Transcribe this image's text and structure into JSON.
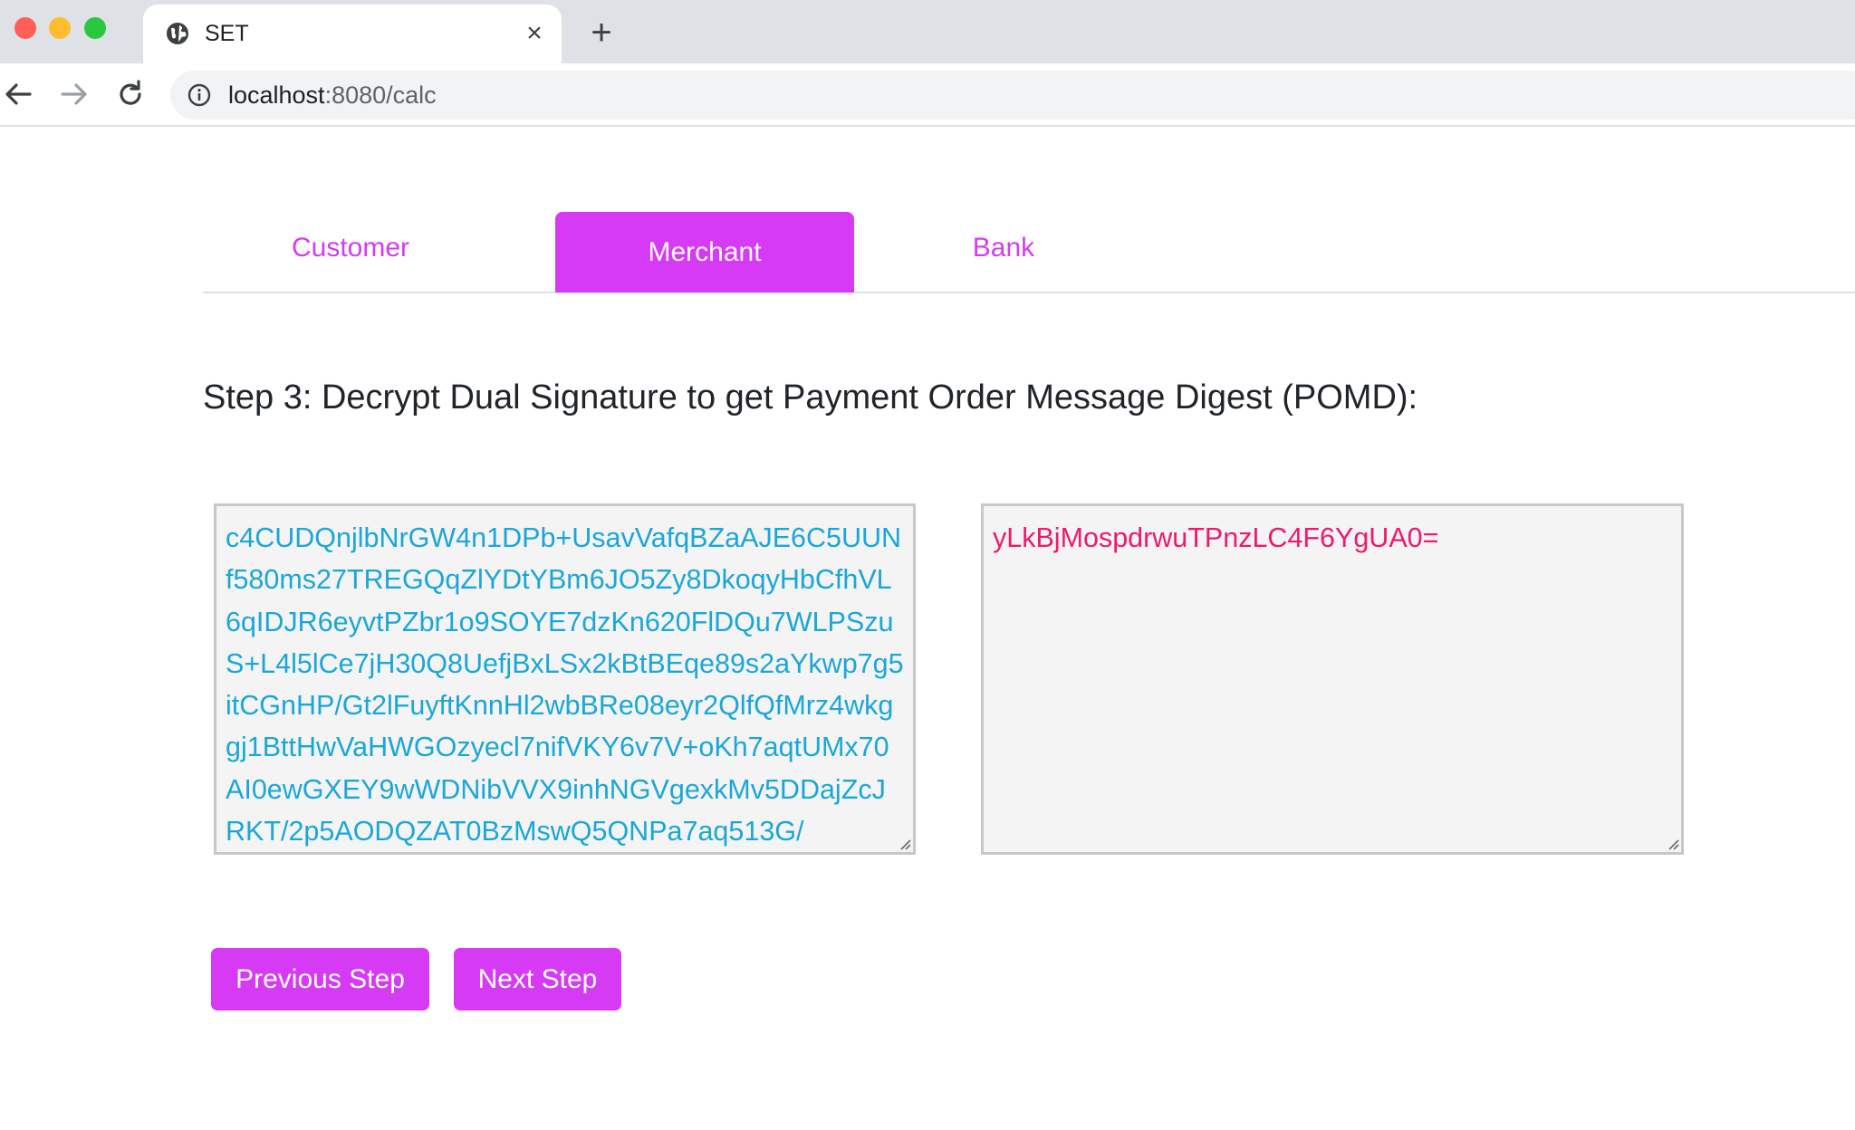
{
  "browser": {
    "tab_title": "SET",
    "url_host": "localhost",
    "url_path": ":8080/calc"
  },
  "nav_tabs": [
    {
      "label": "Customer",
      "active": false
    },
    {
      "label": "Merchant",
      "active": true
    },
    {
      "label": "Bank",
      "active": false
    }
  ],
  "step": {
    "heading": "Step 3: Decrypt Dual Signature to get Payment Order Message Digest (POMD):"
  },
  "fields": {
    "dual_signature": "c4CUDQnjlbNrGW4n1DPb+UsavVafqBZaAJE6C5UUNf580ms27TREGQqZlYDtYBm6JO5Zy8DkoqyHbCfhVL6qIDJR6eyvtPZbr1o9SOYE7dzKn620FlDQu7WLPSzuS+L4l5lCe7jH30Q8UefjBxLSx2kBtBEqe89s2aYkwp7g5itCGnHP/Gt2lFuyftKnnHl2wbBRe08eyr2QlfQfMrz4wkggj1BttHwVaHWGOzyecl7nifVKY6v7V+oKh7aqtUMx70AI0ewGXEY9wWDNibVVX9inhNGVgexkMv5DDajZcJRKT/2p5AODQZAT0BzMswQ5QNPa7aq513G/",
    "pomd": "yLkBjMospdrwuTPnzLC4F6YgUA0="
  },
  "buttons": {
    "previous": "Previous Step",
    "next": "Next Step"
  },
  "colors": {
    "accent": "#d63af5",
    "cipher_text": "#1aa7d8",
    "digest_text": "#ef1a6a"
  }
}
